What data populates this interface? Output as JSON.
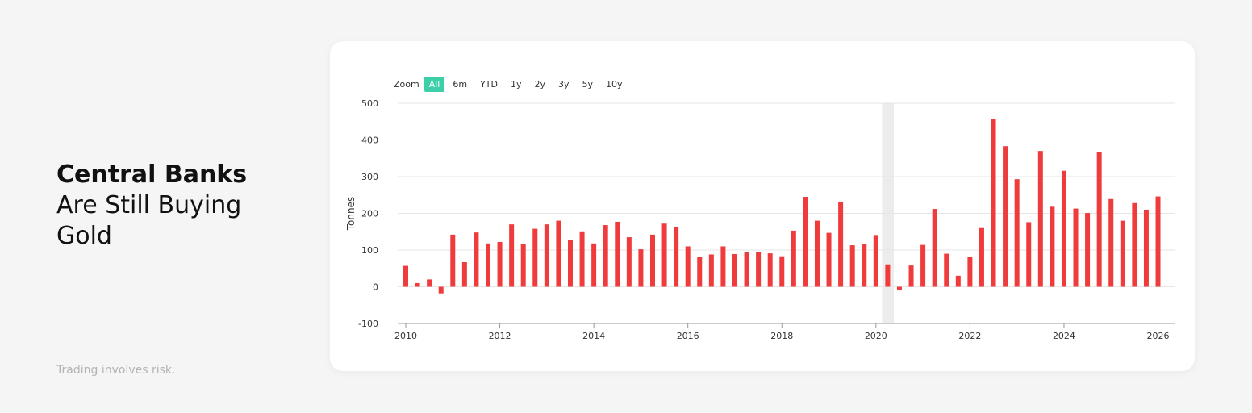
{
  "headline": {
    "bold": "Central Banks",
    "light": "Are Still Buying Gold"
  },
  "disclaimer": "Trading involves risk.",
  "zoom": {
    "label": "Zoom",
    "selected": "All",
    "options": [
      "All",
      "6m",
      "YTD",
      "1y",
      "2y",
      "3y",
      "5y",
      "10y"
    ]
  },
  "colors": {
    "bar": "#ef3b3b",
    "active_zoom": "#3ccfa8",
    "highlight_band": "#ececec"
  },
  "chart_data": {
    "type": "bar",
    "ylabel": "Tonnes",
    "xlabel": "",
    "title": "",
    "ylim": [
      -100,
      500
    ],
    "xlim": [
      2010,
      2026.3
    ],
    "grid": true,
    "y_ticks": [
      "-100",
      "0",
      "100",
      "200",
      "300",
      "400",
      "500"
    ],
    "x_ticks": [
      "2010",
      "2012",
      "2014",
      "2016",
      "2018",
      "2020",
      "2022",
      "2024",
      "2026"
    ],
    "highlight_band": [
      2020.13,
      2020.38
    ],
    "series": [
      {
        "x": [
          2010.0,
          2010.25,
          2010.5,
          2010.75,
          2011.0,
          2011.25,
          2011.5,
          2011.75,
          2012.0,
          2012.25,
          2012.5,
          2012.75,
          2013.0,
          2013.25,
          2013.5,
          2013.75,
          2014.0,
          2014.25,
          2014.5,
          2014.75,
          2015.0,
          2015.25,
          2015.5,
          2015.75,
          2016.0,
          2016.25,
          2016.5,
          2016.75,
          2017.0,
          2017.25,
          2017.5,
          2017.75,
          2018.0,
          2018.25,
          2018.5,
          2018.75,
          2019.0,
          2019.25,
          2019.5,
          2019.75,
          2020.0,
          2020.25,
          2020.5,
          2020.75,
          2021.0,
          2021.25,
          2021.5,
          2021.75,
          2022.0,
          2022.25,
          2022.5,
          2022.75,
          2023.0,
          2023.25,
          2023.5,
          2023.75,
          2024.0,
          2024.25,
          2024.5,
          2024.75,
          2025.0,
          2025.25,
          2025.5,
          2025.75,
          2026.0
        ],
        "values": [
          57,
          10,
          20,
          -18,
          142,
          67,
          148,
          118,
          122,
          170,
          117,
          158,
          170,
          180,
          127,
          151,
          118,
          168,
          177,
          135,
          102,
          142,
          172,
          163,
          110,
          82,
          88,
          110,
          89,
          94,
          94,
          91,
          83,
          153,
          245,
          180,
          147,
          232,
          113,
          117,
          141,
          61,
          -10,
          58,
          114,
          212,
          90,
          30,
          82,
          160,
          456,
          383,
          293,
          176,
          370,
          218,
          316,
          213,
          201,
          367,
          239,
          180,
          228,
          210,
          246
        ]
      }
    ]
  }
}
